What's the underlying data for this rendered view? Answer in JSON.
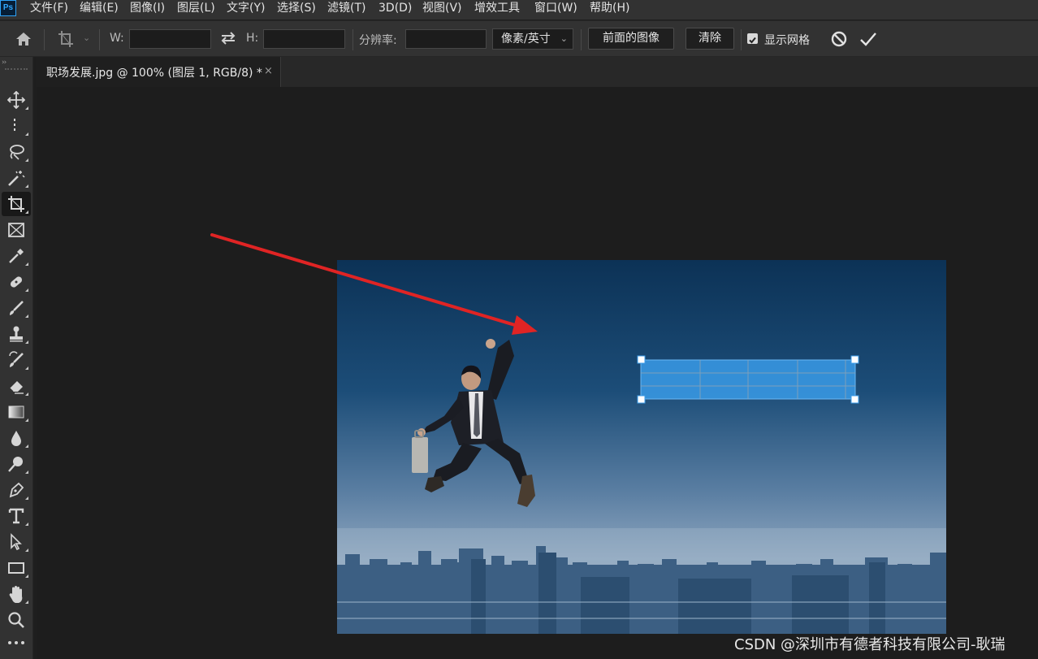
{
  "app": {
    "logo": "Ps"
  },
  "menu": [
    {
      "label": "文件(F)"
    },
    {
      "label": "编辑(E)"
    },
    {
      "label": "图像(I)"
    },
    {
      "label": "图层(L)"
    },
    {
      "label": "文字(Y)"
    },
    {
      "label": "选择(S)"
    },
    {
      "label": "滤镜(T)"
    },
    {
      "label": "3D(D)"
    },
    {
      "label": "视图(V)"
    },
    {
      "label": "增效工具"
    },
    {
      "label": "窗口(W)"
    },
    {
      "label": "帮助(H)"
    }
  ],
  "options": {
    "width_label": "W:",
    "width_value": "",
    "height_label": "H:",
    "height_value": "",
    "resolution_label": "分辨率:",
    "resolution_value": "",
    "unit_select": "像素/英寸",
    "front_image_button": "前面的图像",
    "clear_button": "清除",
    "show_grid_label": "显示网格",
    "show_grid_checked": true
  },
  "document": {
    "tab_title": "职场发展.jpg @ 100% (图层 1, RGB/8) *",
    "close_glyph": "×"
  },
  "tools": [
    {
      "icon": "move-icon"
    },
    {
      "icon": "marquee-icon"
    },
    {
      "icon": "lasso-icon"
    },
    {
      "icon": "magic-wand-icon"
    },
    {
      "icon": "crop-icon",
      "active": true
    },
    {
      "icon": "frame-icon"
    },
    {
      "icon": "eyedropper-icon"
    },
    {
      "icon": "healing-brush-icon"
    },
    {
      "icon": "brush-icon"
    },
    {
      "icon": "clone-stamp-icon"
    },
    {
      "icon": "history-brush-icon"
    },
    {
      "icon": "eraser-icon"
    },
    {
      "icon": "gradient-icon"
    },
    {
      "icon": "blur-icon"
    },
    {
      "icon": "dodge-icon"
    },
    {
      "icon": "pen-icon"
    },
    {
      "icon": "type-icon"
    },
    {
      "icon": "path-selection-icon"
    },
    {
      "icon": "rectangle-icon"
    },
    {
      "icon": "hand-icon"
    },
    {
      "icon": "zoom-icon"
    },
    {
      "icon": "more-tools-icon"
    }
  ],
  "colors": {
    "accent": "#31a8ff",
    "arrow": "#e02424",
    "selection": "#3a9be8"
  },
  "watermark": "CSDN @深圳市有德者科技有限公司-耿瑞"
}
